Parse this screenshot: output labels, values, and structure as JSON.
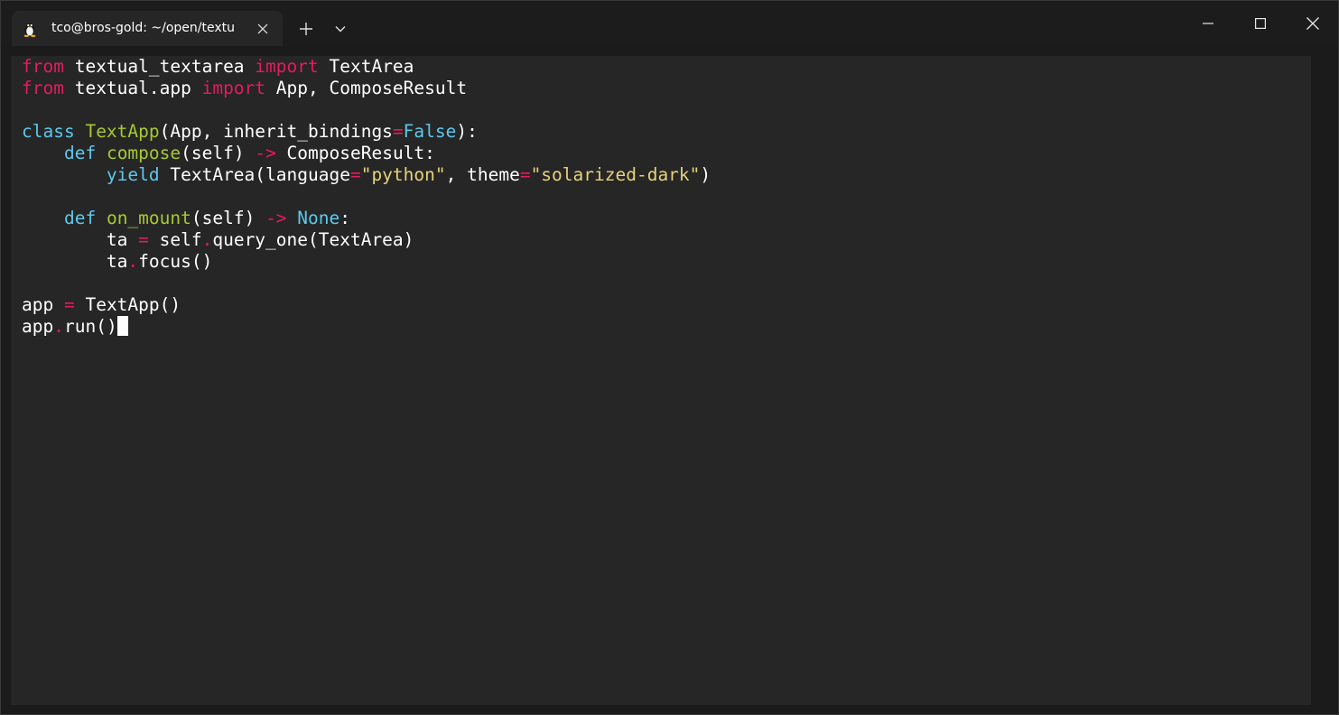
{
  "window": {
    "tab_title": "tco@bros-gold: ~/open/textu",
    "tab_icon": "linux-penguin-icon",
    "controls": {
      "minimize": "minimize-icon",
      "maximize": "maximize-icon",
      "close": "close-icon"
    }
  },
  "colors": {
    "keyword": "#e8195e",
    "builtin": "#5ec8ec",
    "function": "#a8c832",
    "string": "#e6d27a",
    "text": "#ffffff",
    "background": "#262626"
  },
  "code_lines": [
    [
      {
        "t": "from",
        "c": "kw"
      },
      {
        "t": " textual_textarea ",
        "c": "plain"
      },
      {
        "t": "import",
        "c": "kw"
      },
      {
        "t": " TextArea",
        "c": "plain"
      }
    ],
    [
      {
        "t": "from",
        "c": "kw"
      },
      {
        "t": " textual.app ",
        "c": "plain"
      },
      {
        "t": "import",
        "c": "kw"
      },
      {
        "t": " App, ComposeResult",
        "c": "plain"
      }
    ],
    [],
    [
      {
        "t": "class",
        "c": "def"
      },
      {
        "t": " ",
        "c": "plain"
      },
      {
        "t": "TextApp",
        "c": "fn"
      },
      {
        "t": "(App, inherit_bindings",
        "c": "plain"
      },
      {
        "t": "=",
        "c": "kw"
      },
      {
        "t": "False",
        "c": "def"
      },
      {
        "t": "):",
        "c": "plain"
      }
    ],
    [
      {
        "t": "    ",
        "c": "plain"
      },
      {
        "t": "def",
        "c": "def"
      },
      {
        "t": " ",
        "c": "plain"
      },
      {
        "t": "compose",
        "c": "fn"
      },
      {
        "t": "(self) ",
        "c": "plain"
      },
      {
        "t": "->",
        "c": "kw"
      },
      {
        "t": " ComposeResult:",
        "c": "plain"
      }
    ],
    [
      {
        "t": "        ",
        "c": "plain"
      },
      {
        "t": "yield",
        "c": "def"
      },
      {
        "t": " TextArea(language",
        "c": "plain"
      },
      {
        "t": "=",
        "c": "kw"
      },
      {
        "t": "\"python\"",
        "c": "str"
      },
      {
        "t": ", theme",
        "c": "plain"
      },
      {
        "t": "=",
        "c": "kw"
      },
      {
        "t": "\"solarized-dark\"",
        "c": "str"
      },
      {
        "t": ")",
        "c": "plain"
      }
    ],
    [],
    [
      {
        "t": "    ",
        "c": "plain"
      },
      {
        "t": "def",
        "c": "def"
      },
      {
        "t": " ",
        "c": "plain"
      },
      {
        "t": "on_mount",
        "c": "fn"
      },
      {
        "t": "(self) ",
        "c": "plain"
      },
      {
        "t": "->",
        "c": "kw"
      },
      {
        "t": " ",
        "c": "plain"
      },
      {
        "t": "None",
        "c": "def"
      },
      {
        "t": ":",
        "c": "plain"
      }
    ],
    [
      {
        "t": "        ta ",
        "c": "plain"
      },
      {
        "t": "=",
        "c": "kw"
      },
      {
        "t": " self",
        "c": "plain"
      },
      {
        "t": ".",
        "c": "kw"
      },
      {
        "t": "query_one(TextArea)",
        "c": "plain"
      }
    ],
    [
      {
        "t": "        ta",
        "c": "plain"
      },
      {
        "t": ".",
        "c": "kw"
      },
      {
        "t": "focus()",
        "c": "plain"
      }
    ],
    [],
    [
      {
        "t": "app ",
        "c": "plain"
      },
      {
        "t": "=",
        "c": "kw"
      },
      {
        "t": " TextApp()",
        "c": "plain"
      }
    ],
    [
      {
        "t": "app",
        "c": "plain"
      },
      {
        "t": ".",
        "c": "kw"
      },
      {
        "t": "run()",
        "c": "plain"
      }
    ]
  ],
  "cursor_line": 12
}
